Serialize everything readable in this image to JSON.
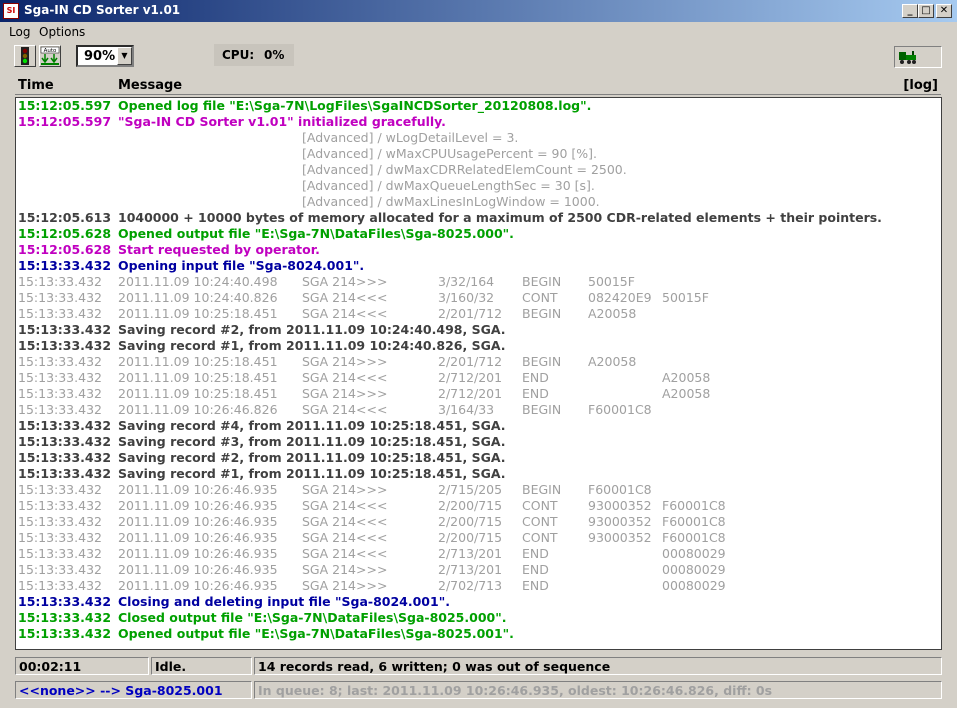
{
  "window": {
    "icon_text": "SI",
    "title": "Sga-IN CD Sorter  v1.01",
    "controls": {
      "minimize": "_",
      "maximize": "□",
      "close": "✕"
    }
  },
  "menu": {
    "items": [
      "Log",
      "Options"
    ]
  },
  "toolbar": {
    "auto_label": "Auto",
    "zoom_value": "90%",
    "cpu_label": "CPU:",
    "cpu_value": "0%"
  },
  "header": {
    "time": "Time",
    "message": "Message",
    "log_tag": "[log]"
  },
  "log": [
    {
      "time": "15:12:05.597",
      "style": "green",
      "cols": [
        "Opened log file \"E:\\Sga-7N\\LogFiles\\SgaINCDSorter_20120808.log\"."
      ]
    },
    {
      "time": "15:12:05.597",
      "style": "magenta",
      "cols": [
        "\"Sga-IN CD Sorter  v1.01\" initialized gracefully."
      ]
    },
    {
      "time": "",
      "style": "lgray",
      "indent": true,
      "cols": [
        "[Advanced] / wLogDetailLevel = 3."
      ]
    },
    {
      "time": "",
      "style": "lgray",
      "indent": true,
      "cols": [
        "[Advanced] / wMaxCPUUsagePercent = 90 [%]."
      ]
    },
    {
      "time": "",
      "style": "lgray",
      "indent": true,
      "cols": [
        "[Advanced] / dwMaxCDRRelatedElemCount = 2500."
      ]
    },
    {
      "time": "",
      "style": "lgray",
      "indent": true,
      "cols": [
        "[Advanced] / dwMaxQueueLengthSec = 30 [s]."
      ]
    },
    {
      "time": "",
      "style": "lgray",
      "indent": true,
      "cols": [
        "[Advanced] / dwMaxLinesInLogWindow = 1000."
      ]
    },
    {
      "time": "15:12:05.613",
      "style": "dark",
      "cols": [
        "1040000 + 10000 bytes of memory allocated for a maximum of 2500 CDR-related elements + their pointers."
      ]
    },
    {
      "time": "15:12:05.628",
      "style": "green",
      "cols": [
        "Opened output file \"E:\\Sga-7N\\DataFiles\\Sga-8025.000\"."
      ]
    },
    {
      "time": "15:12:05.628",
      "style": "magenta",
      "cols": [
        "Start requested by operator."
      ]
    },
    {
      "time": "15:13:33.432",
      "style": "blue",
      "cols": [
        "Opening input file \"Sga-8024.001\"."
      ]
    },
    {
      "time": "15:13:33.432",
      "style": "lgray",
      "cols": [
        "2011.11.09 10:24:40.498",
        "SGA  214>>>",
        "3/32/164",
        "BEGIN",
        "50015F",
        ""
      ]
    },
    {
      "time": "15:13:33.432",
      "style": "lgray",
      "cols": [
        "2011.11.09 10:24:40.826",
        "SGA  214<<<",
        "3/160/32",
        "CONT",
        "082420E9",
        "50015F"
      ]
    },
    {
      "time": "15:13:33.432",
      "style": "lgray",
      "cols": [
        "2011.11.09 10:25:18.451",
        "SGA  214<<<",
        "2/201/712",
        "BEGIN",
        "A20058",
        ""
      ]
    },
    {
      "time": "15:13:33.432",
      "style": "dark",
      "cols": [
        "Saving record #2, from 2011.11.09 10:24:40.498, SGA."
      ]
    },
    {
      "time": "15:13:33.432",
      "style": "dark",
      "cols": [
        "Saving record #1, from 2011.11.09 10:24:40.826, SGA."
      ]
    },
    {
      "time": "15:13:33.432",
      "style": "lgray",
      "cols": [
        "2011.11.09 10:25:18.451",
        "SGA  214>>>",
        "2/201/712",
        "BEGIN",
        "A20058",
        ""
      ]
    },
    {
      "time": "15:13:33.432",
      "style": "lgray",
      "cols": [
        "2011.11.09 10:25:18.451",
        "SGA  214<<<",
        "2/712/201",
        "END",
        "",
        "A20058"
      ]
    },
    {
      "time": "15:13:33.432",
      "style": "lgray",
      "cols": [
        "2011.11.09 10:25:18.451",
        "SGA  214>>>",
        "2/712/201",
        "END",
        "",
        "A20058"
      ]
    },
    {
      "time": "15:13:33.432",
      "style": "lgray",
      "cols": [
        "2011.11.09 10:26:46.826",
        "SGA  214<<<",
        "3/164/33",
        "BEGIN",
        "F60001C8",
        ""
      ]
    },
    {
      "time": "15:13:33.432",
      "style": "dark",
      "cols": [
        "Saving record #4, from 2011.11.09 10:25:18.451, SGA."
      ]
    },
    {
      "time": "15:13:33.432",
      "style": "dark",
      "cols": [
        "Saving record #3, from 2011.11.09 10:25:18.451, SGA."
      ]
    },
    {
      "time": "15:13:33.432",
      "style": "dark",
      "cols": [
        "Saving record #2, from 2011.11.09 10:25:18.451, SGA."
      ]
    },
    {
      "time": "15:13:33.432",
      "style": "dark",
      "cols": [
        "Saving record #1, from 2011.11.09 10:25:18.451, SGA."
      ]
    },
    {
      "time": "15:13:33.432",
      "style": "lgray",
      "cols": [
        "2011.11.09 10:26:46.935",
        "SGA  214>>>",
        "2/715/205",
        "BEGIN",
        "F60001C8",
        ""
      ]
    },
    {
      "time": "15:13:33.432",
      "style": "lgray",
      "cols": [
        "2011.11.09 10:26:46.935",
        "SGA  214<<<",
        "2/200/715",
        "CONT",
        "93000352",
        "F60001C8"
      ]
    },
    {
      "time": "15:13:33.432",
      "style": "lgray",
      "cols": [
        "2011.11.09 10:26:46.935",
        "SGA  214<<<",
        "2/200/715",
        "CONT",
        "93000352",
        "F60001C8"
      ]
    },
    {
      "time": "15:13:33.432",
      "style": "lgray",
      "cols": [
        "2011.11.09 10:26:46.935",
        "SGA  214<<<",
        "2/200/715",
        "CONT",
        "93000352",
        "F60001C8"
      ]
    },
    {
      "time": "15:13:33.432",
      "style": "lgray",
      "cols": [
        "2011.11.09 10:26:46.935",
        "SGA  214<<<",
        "2/713/201",
        "END",
        "",
        "00080029"
      ]
    },
    {
      "time": "15:13:33.432",
      "style": "lgray",
      "cols": [
        "2011.11.09 10:26:46.935",
        "SGA  214>>>",
        "2/713/201",
        "END",
        "",
        "00080029"
      ]
    },
    {
      "time": "15:13:33.432",
      "style": "lgray",
      "cols": [
        "2011.11.09 10:26:46.935",
        "SGA  214>>>",
        "2/702/713",
        "END",
        "",
        "00080029"
      ]
    },
    {
      "time": "15:13:33.432",
      "style": "blue",
      "cols": [
        "Closing and deleting input file \"Sga-8024.001\"."
      ]
    },
    {
      "time": "15:13:33.432",
      "style": "green",
      "cols": [
        "Closed output file \"E:\\Sga-7N\\DataFiles\\Sga-8025.000\"."
      ]
    },
    {
      "time": "15:13:33.432",
      "style": "green",
      "cols": [
        "Opened output file \"E:\\Sga-7N\\DataFiles\\Sga-8025.001\"."
      ]
    }
  ],
  "status": {
    "elapsed": "00:02:11",
    "state": "Idle.",
    "records": "14 records read, 6 written; 0 was out of sequence",
    "route": "<<none>> --> Sga-8025.001",
    "queue": "In queue: 8; last: 2011.11.09 10:26:46.935, oldest: 10:26:46.826, diff: 0s"
  },
  "colors": {
    "green": "#00a000",
    "magenta": "#c000c0",
    "blue": "#0000a0",
    "dark": "#404040",
    "light_gray": "#a0a0a0",
    "title_start": "#0a246a",
    "title_end": "#a6caf0"
  },
  "icons": {
    "app": "app-icon",
    "traffic_light": "traffic-light-icon",
    "auto": "auto-download-icon",
    "engine": "locomotive-icon"
  }
}
